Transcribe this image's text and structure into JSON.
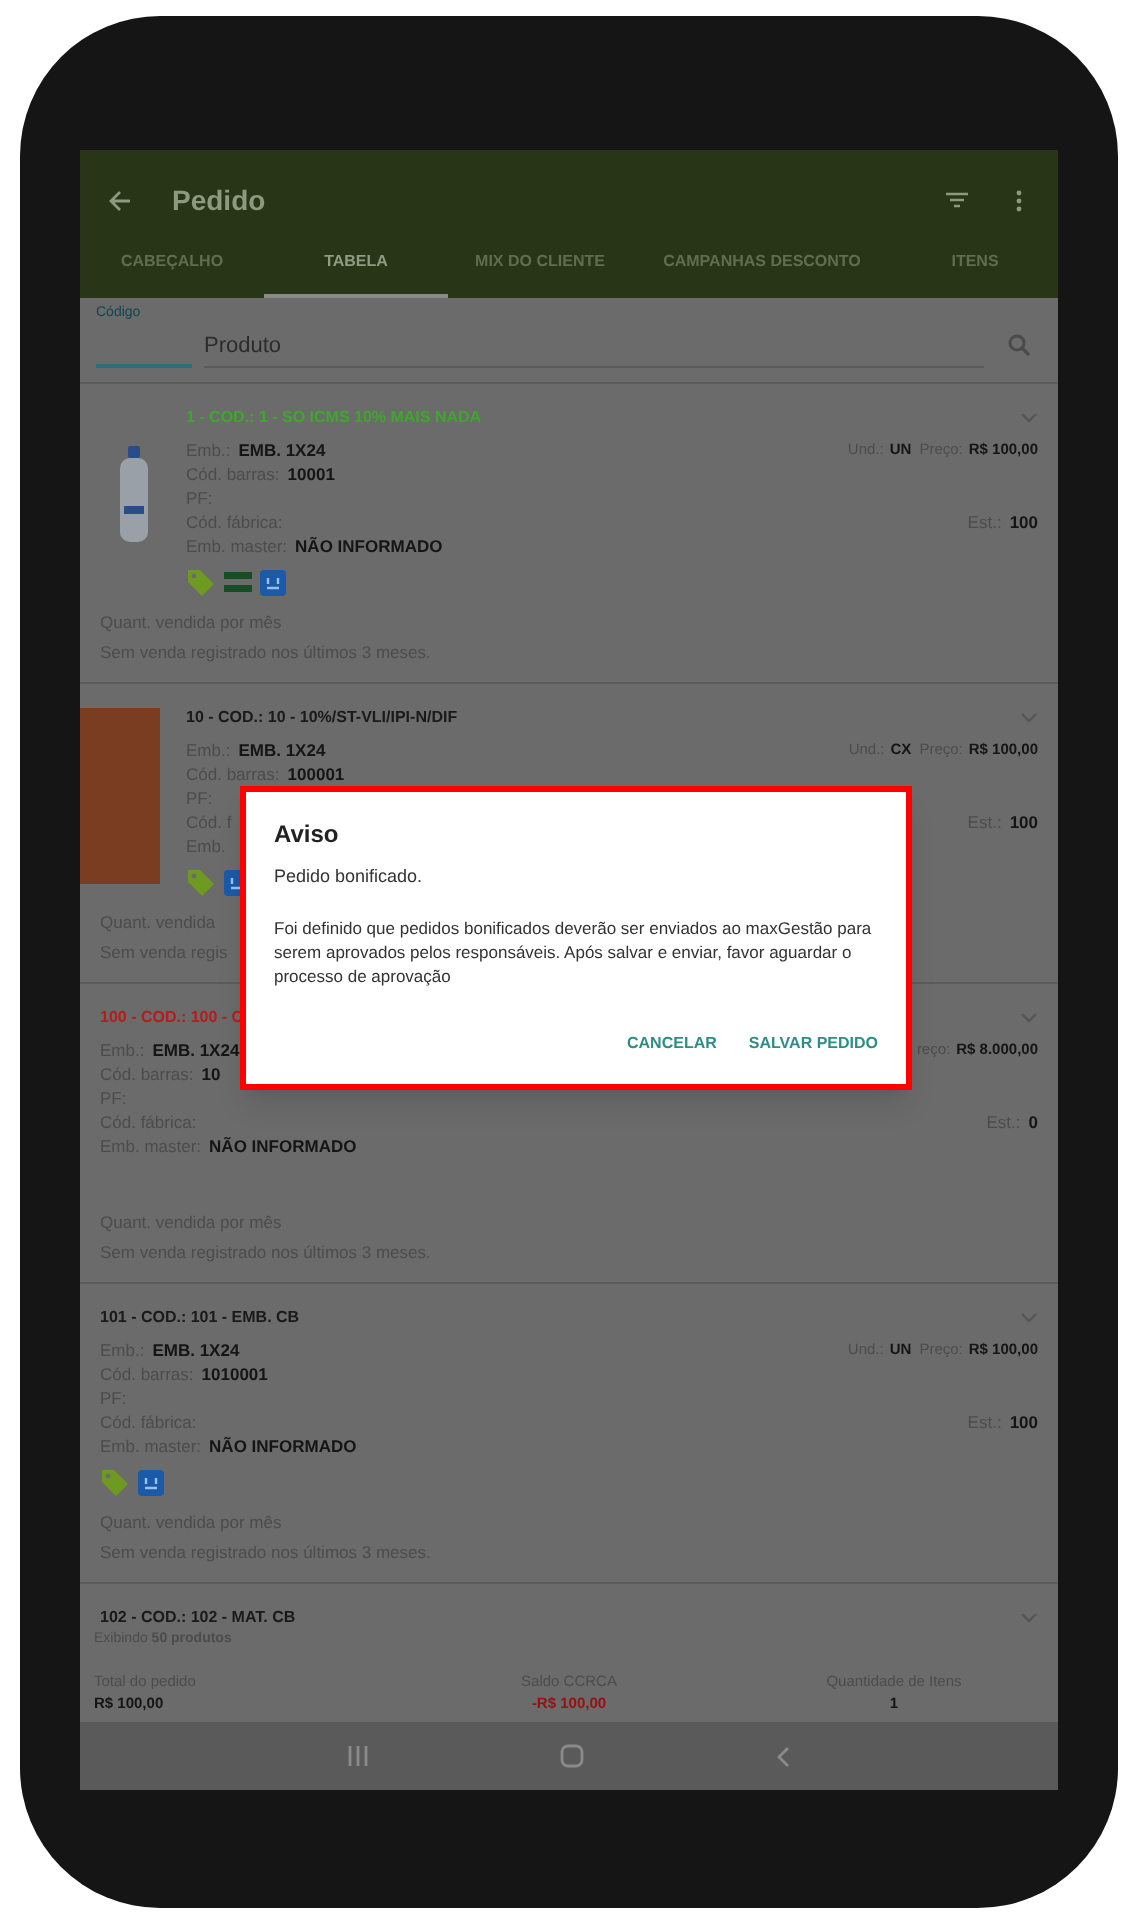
{
  "toolbar": {
    "title": "Pedido"
  },
  "tabs": [
    {
      "label": "CABEÇALHO",
      "selected": false
    },
    {
      "label": "TABELA",
      "selected": true
    },
    {
      "label": "MIX DO CLIENTE",
      "selected": false
    },
    {
      "label": "CAMPANHAS DESCONTO",
      "selected": false
    },
    {
      "label": "ITENS",
      "selected": false
    }
  ],
  "search": {
    "code_label": "Código",
    "product_placeholder": "Produto"
  },
  "products": [
    {
      "title": "1 - COD.: 1 - SO ICMS 10% MAIS NADA",
      "color": "#3fa82c",
      "fields": [
        {
          "label": "Emb.:",
          "value": "EMB. 1X24"
        },
        {
          "label": "Cód. barras:",
          "value": "10001"
        },
        {
          "label": "PF:"
        },
        {
          "label": "Cód. fábrica:"
        },
        {
          "label": "Emb. master:",
          "value": "NÃO INFORMADO"
        }
      ],
      "top_right": [
        {
          "label": "Und.:",
          "value": "UN"
        },
        {
          "label": "Preço:",
          "value": "R$ 100,00"
        }
      ],
      "stock": {
        "label": "Est.:",
        "value": "100"
      },
      "icons": [
        {
          "kind": "tag"
        },
        {
          "kind": "equals"
        },
        {
          "kind": "box"
        }
      ],
      "quant_label": "Quant. vendida por mês",
      "quant_text": "Sem venda registrado nos últimos 3 meses."
    },
    {
      "title": "10 - COD.: 10 - 10%/ST-VLI/IPI-N/DIF",
      "color": "#1a1a1a",
      "fields": [
        {
          "label": "Emb.:",
          "value": "EMB. 1X24"
        },
        {
          "label": "Cód. barras:",
          "value": "100001"
        },
        {
          "label": "PF:"
        },
        {
          "label": "Cód. f"
        },
        {
          "label": "Emb."
        }
      ],
      "top_right": [
        {
          "label": "Und.:",
          "value": "CX"
        },
        {
          "label": "Preço:",
          "value": "R$ 100,00"
        }
      ],
      "stock": {
        "label": "Est.:",
        "value": "100"
      },
      "icons": [
        {
          "kind": "tag"
        },
        {
          "kind": "box"
        }
      ],
      "quant_label": "Quant. vendida",
      "quant_text": "Sem venda regis"
    },
    {
      "title": "100 - COD.: 100 - C",
      "color": "#b51c1c",
      "fields": [
        {
          "label": "Emb.:",
          "value": "EMB. 1X24"
        },
        {
          "label": "Cód. barras:",
          "value": "10"
        },
        {
          "label": "PF:"
        },
        {
          "label": "Cód. fábrica:"
        },
        {
          "label": "Emb. master:",
          "value": "NÃO INFORMADO"
        }
      ],
      "top_right": [
        {
          "label": "reço:",
          "value": "R$ 8.000,00"
        }
      ],
      "stock": {
        "label": "Est.:",
        "value": "0"
      },
      "quant_label": "Quant. vendida por mês",
      "quant_text": "Sem venda registrado nos últimos 3 meses."
    },
    {
      "title": "101 - COD.: 101 - EMB. CB",
      "color": "#1a1a1a",
      "fields": [
        {
          "label": "Emb.:",
          "value": "EMB. 1X24"
        },
        {
          "label": "Cód. barras:",
          "value": "1010001"
        },
        {
          "label": "PF:"
        },
        {
          "label": "Cód. fábrica:"
        },
        {
          "label": "Emb. master:",
          "value": "NÃO INFORMADO"
        }
      ],
      "top_right": [
        {
          "label": "Und.:",
          "value": "UN"
        },
        {
          "label": "Preço:",
          "value": "R$ 100,00"
        }
      ],
      "stock": {
        "label": "Est.:",
        "value": "100"
      },
      "icons": [
        {
          "kind": "tag"
        },
        {
          "kind": "box"
        }
      ],
      "quant_label": "Quant. vendida por mês",
      "quant_text": "Sem venda registrado nos últimos 3 meses."
    },
    {
      "title": "102 - COD.: 102 - MAT. CB",
      "color": "#1a1a1a"
    }
  ],
  "count": "Exibindo **50 produtos**",
  "totals": [
    {
      "label": "Total do pedido",
      "value": "R$ 100,00",
      "color": "#151515"
    },
    {
      "label": "Saldo CCRCA",
      "value": "-R$ 100,00",
      "color": "#9a1010"
    },
    {
      "label": "Quantidade de Itens",
      "value": "1",
      "color": "#151515"
    }
  ],
  "dialog": {
    "title": "Aviso",
    "subtitle": "Pedido bonificado.",
    "message": "Foi definido que pedidos bonificados deverão ser enviados ao maxGestão para serem aprovados pelos responsáveis. Após salvar e enviar, favor aguardar o processo de aprovação",
    "buttons": [
      "CANCELAR",
      "SALVAR PEDIDO"
    ]
  }
}
